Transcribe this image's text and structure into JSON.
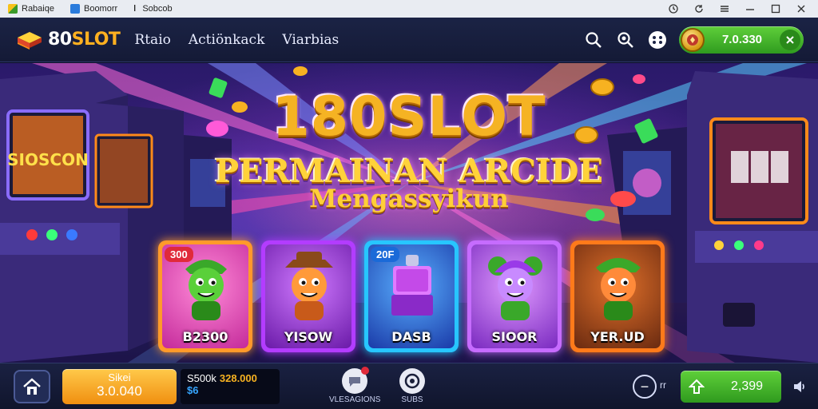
{
  "titlebar": {
    "tab1": "Rabaiqe",
    "tab2": "Boomorr",
    "tab3": "Sobcob",
    "buttons": [
      "clock-icon",
      "refresh-icon",
      "menu-icon",
      "minimize-icon",
      "maximize-icon",
      "close-icon"
    ]
  },
  "header": {
    "logo_prefix": "80",
    "logo_suffix": "SLOT",
    "nav": [
      "Rtaio",
      "Actiönkack",
      "Viarbias"
    ],
    "icons": [
      "search-icon",
      "zoom-icon",
      "gamepad-icon"
    ],
    "balance": "7.0.330"
  },
  "hero": {
    "title": "180SLOT",
    "line2": "PERMAINAN ARCIDE",
    "line3": "Mengassyikun"
  },
  "games": [
    {
      "label": "B2300",
      "badge": "300",
      "colors": {
        "frame": "#ff9a2a",
        "bg": "#ff4fc2"
      }
    },
    {
      "label": "YISOW",
      "badge": "",
      "colors": {
        "frame": "#b33cff",
        "bg": "#8a2bd6"
      }
    },
    {
      "label": "DASB",
      "badge": "20F",
      "colors": {
        "frame": "#27c6ff",
        "bg": "#2b63d6"
      }
    },
    {
      "label": "SIOOR",
      "badge": "",
      "colors": {
        "frame": "#c66cff",
        "bg": "#9b3ee0"
      }
    },
    {
      "label": "YER.UD",
      "badge": "",
      "colors": {
        "frame": "#ff7a1a",
        "bg": "#a8431a"
      }
    }
  ],
  "bottom": {
    "bet_line1": "Sikei",
    "bet_line2": "3.0.040",
    "stats_label": "S500k",
    "stats_value": "328.000",
    "stats_sub": "$6",
    "icon1_label": "VLESAGIONS",
    "icon2_label": "SUBS",
    "minus": "−",
    "small": "rr",
    "win_value": "2,399"
  },
  "colors": {
    "accent": "#f5b323",
    "green": "#3fb52a",
    "orange": "#f39a18"
  }
}
